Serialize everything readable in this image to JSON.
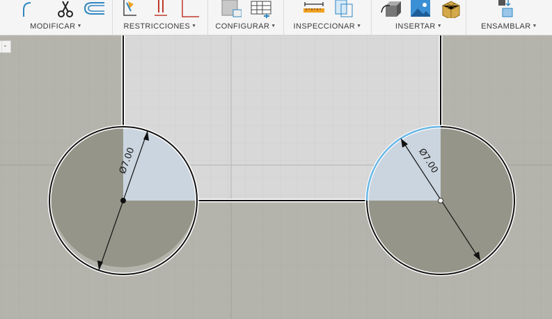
{
  "toolbar": {
    "groups": [
      {
        "label": "MODIFICAR",
        "icons": [
          "fillet-icon",
          "trim-icon",
          "offset-icon"
        ]
      },
      {
        "label": "RESTRICCIONES",
        "icons": [
          "fix-constraint-icon",
          "horizontal-vertical-constraint-icon",
          "perpendicular-constraint-icon"
        ]
      },
      {
        "label": "CONFIGURAR",
        "icons": [
          "sketch-palette-icon",
          "table-icon"
        ]
      },
      {
        "label": "INSPECCIONAR",
        "icons": [
          "measure-icon",
          "interference-icon"
        ]
      },
      {
        "label": "INSERTAR",
        "icons": [
          "insert-derive-icon",
          "insert-image-icon",
          "insert-mesh-icon"
        ]
      },
      {
        "label": "ENSAMBLAR",
        "icons": [
          "new-component-icon"
        ]
      }
    ],
    "collapse_symbol": "-"
  },
  "sketch": {
    "dimensions": [
      {
        "label": "Ø7.00",
        "circle": "left"
      },
      {
        "label": "Ø7.00",
        "circle": "right"
      }
    ]
  },
  "colors": {
    "canvas_background": "#b4b4ac",
    "sketch_fill": "#d8d8d8",
    "circle_fill": "#959589",
    "selected_arc": "#6ab8e8",
    "profile_line": "#111111",
    "toolbar_background": "#f5f5f5"
  }
}
